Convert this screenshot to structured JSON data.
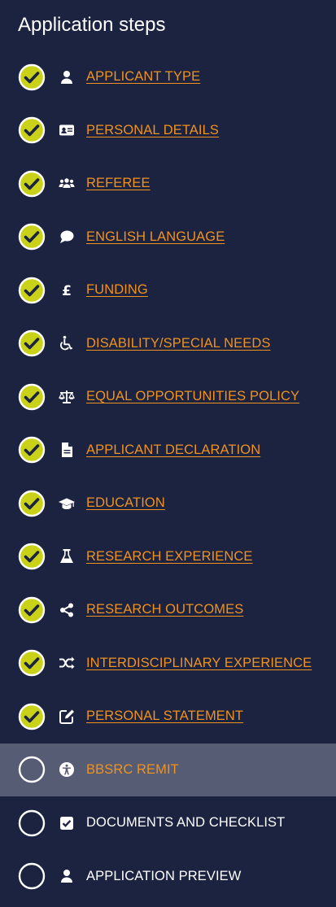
{
  "panel": {
    "title": "Application steps",
    "steps": [
      {
        "label": "APPLICANT TYPE",
        "icon": "user-icon",
        "status": "complete",
        "linked": true
      },
      {
        "label": "PERSONAL DETAILS",
        "icon": "id-card-icon",
        "status": "complete",
        "linked": true
      },
      {
        "label": "REFEREE",
        "icon": "users-icon",
        "status": "complete",
        "linked": true
      },
      {
        "label": "ENGLISH LANGUAGE",
        "icon": "speech-bubble-icon",
        "status": "complete",
        "linked": true
      },
      {
        "label": "FUNDING",
        "icon": "pound-sign-icon",
        "status": "complete",
        "linked": true
      },
      {
        "label": "DISABILITY/SPECIAL NEEDS",
        "icon": "wheelchair-icon",
        "status": "complete",
        "linked": true
      },
      {
        "label": "EQUAL OPPORTUNITIES POLICY",
        "icon": "balance-scale-icon",
        "status": "complete",
        "linked": true
      },
      {
        "label": "APPLICANT DECLARATION",
        "icon": "document-icon",
        "status": "complete",
        "linked": true
      },
      {
        "label": "EDUCATION",
        "icon": "graduation-cap-icon",
        "status": "complete",
        "linked": true
      },
      {
        "label": "RESEARCH EXPERIENCE",
        "icon": "flask-icon",
        "status": "complete",
        "linked": true
      },
      {
        "label": "RESEARCH OUTCOMES",
        "icon": "share-nodes-icon",
        "status": "complete",
        "linked": true
      },
      {
        "label": "INTERDISCIPLINARY EXPERIENCE",
        "icon": "shuffle-icon",
        "status": "complete",
        "linked": true
      },
      {
        "label": "PERSONAL STATEMENT",
        "icon": "edit-icon",
        "status": "complete",
        "linked": true
      },
      {
        "label": "BBSRC REMIT",
        "icon": "accessibility-icon",
        "status": "current",
        "linked": false
      },
      {
        "label": "DOCUMENTS AND CHECKLIST",
        "icon": "checkbox-icon",
        "status": "incomplete",
        "linked": false
      },
      {
        "label": "APPLICATION PREVIEW",
        "icon": "user-icon",
        "status": "incomplete",
        "linked": false
      }
    ]
  },
  "colors": {
    "background": "#1b2341",
    "current_row": "#575c75",
    "link": "#f0921d",
    "check_fill": "#c9d118",
    "text": "#ffffff"
  }
}
